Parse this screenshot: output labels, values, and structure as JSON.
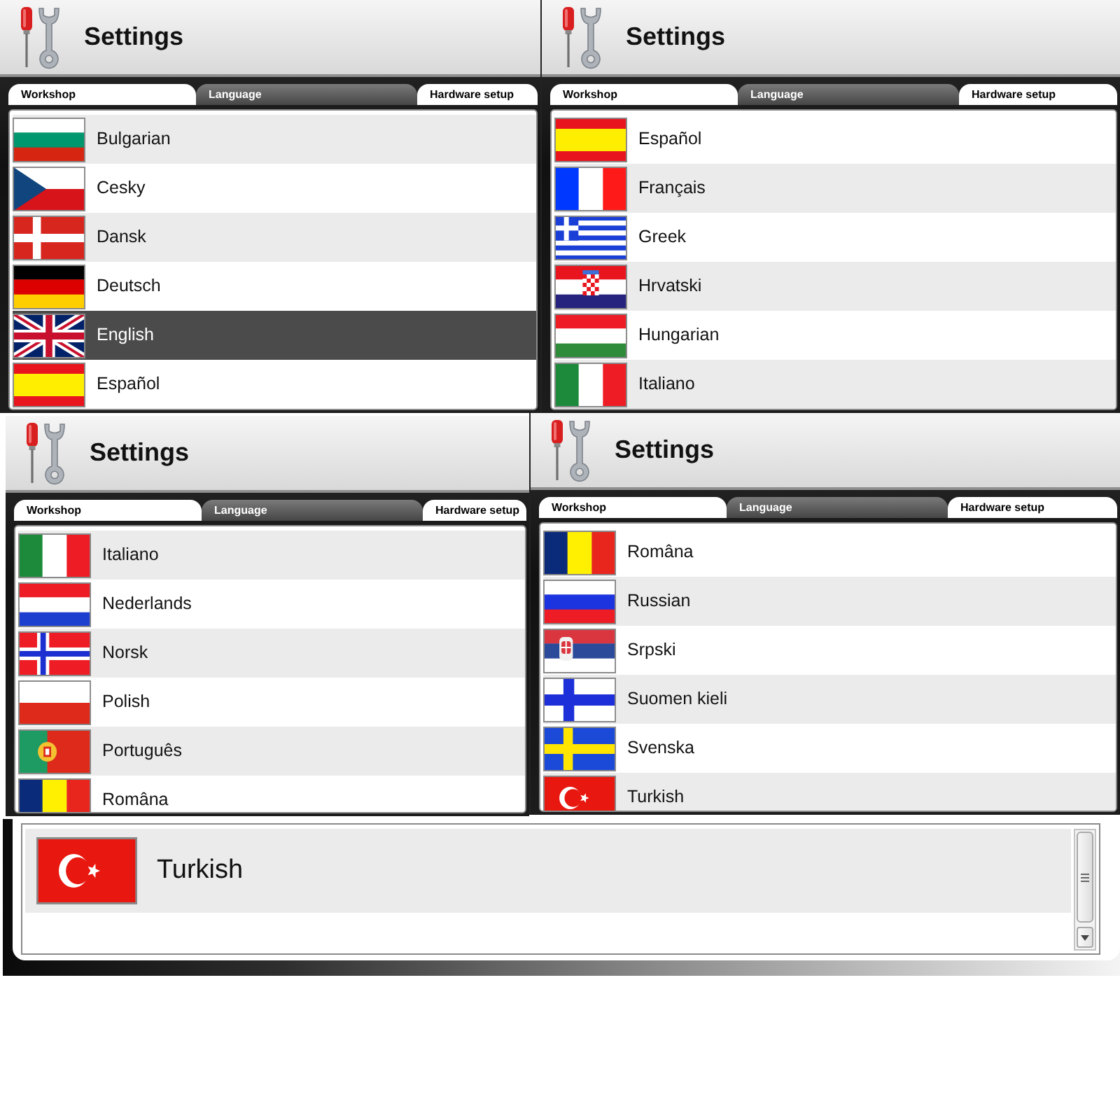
{
  "panels": [
    {
      "kind": "window",
      "title": "Settings",
      "tabs": [
        {
          "label": "Workshop",
          "selected": false
        },
        {
          "label": "Language",
          "selected": true
        },
        {
          "label": "Hardware setup",
          "selected": false
        }
      ],
      "languages": [
        {
          "name": "Bulgarian",
          "selected": false
        },
        {
          "name": "Cesky",
          "selected": false
        },
        {
          "name": "Dansk",
          "selected": false
        },
        {
          "name": "Deutsch",
          "selected": false
        },
        {
          "name": "English",
          "selected": true
        },
        {
          "name": "Español",
          "selected": false
        }
      ]
    },
    {
      "kind": "window",
      "title": "Settings",
      "tabs": [
        {
          "label": "Workshop",
          "selected": false
        },
        {
          "label": "Language",
          "selected": true
        },
        {
          "label": "Hardware setup",
          "selected": false
        }
      ],
      "languages": [
        {
          "name": "Español",
          "selected": false
        },
        {
          "name": "Français",
          "selected": false
        },
        {
          "name": "Greek",
          "selected": false
        },
        {
          "name": "Hrvatski",
          "selected": false
        },
        {
          "name": "Hungarian",
          "selected": false
        },
        {
          "name": "Italiano",
          "selected": false
        }
      ]
    },
    {
      "kind": "window",
      "title": "Settings",
      "tabs": [
        {
          "label": "Workshop",
          "selected": false
        },
        {
          "label": "Language",
          "selected": true
        },
        {
          "label": "Hardware setup",
          "selected": false
        }
      ],
      "languages": [
        {
          "name": "Italiano",
          "selected": false
        },
        {
          "name": "Nederlands",
          "selected": false
        },
        {
          "name": "Norsk",
          "selected": false
        },
        {
          "name": "Polish",
          "selected": false
        },
        {
          "name": "Português",
          "selected": false
        },
        {
          "name": "Româna",
          "selected": false
        }
      ]
    },
    {
      "kind": "window",
      "title": "Settings",
      "tabs": [
        {
          "label": "Workshop",
          "selected": false
        },
        {
          "label": "Language",
          "selected": true
        },
        {
          "label": "Hardware setup",
          "selected": false
        }
      ],
      "languages": [
        {
          "name": "Româna",
          "selected": false
        },
        {
          "name": "Russian",
          "selected": false
        },
        {
          "name": "Srpski",
          "selected": false
        },
        {
          "name": "Suomen kieli",
          "selected": false
        },
        {
          "name": "Svenska",
          "selected": false
        },
        {
          "name": "Turkish",
          "selected": false
        }
      ]
    },
    {
      "kind": "fragment",
      "languages": [
        {
          "name": "Turkish",
          "selected": false
        }
      ]
    }
  ]
}
